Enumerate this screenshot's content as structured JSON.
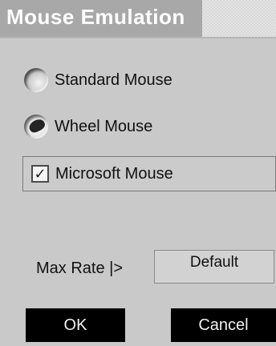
{
  "window": {
    "title": "Mouse Emulation"
  },
  "mouse_type": {
    "options": [
      {
        "label": "Standard Mouse",
        "selected": false
      },
      {
        "label": "Wheel Mouse",
        "selected": true
      }
    ]
  },
  "microsoft_mouse": {
    "label": "Microsoft Mouse",
    "checked": true,
    "mark": "✓"
  },
  "max_rate": {
    "label": "Max Rate |>",
    "value": "Default"
  },
  "buttons": {
    "ok": "OK",
    "cancel": "Cancel"
  }
}
